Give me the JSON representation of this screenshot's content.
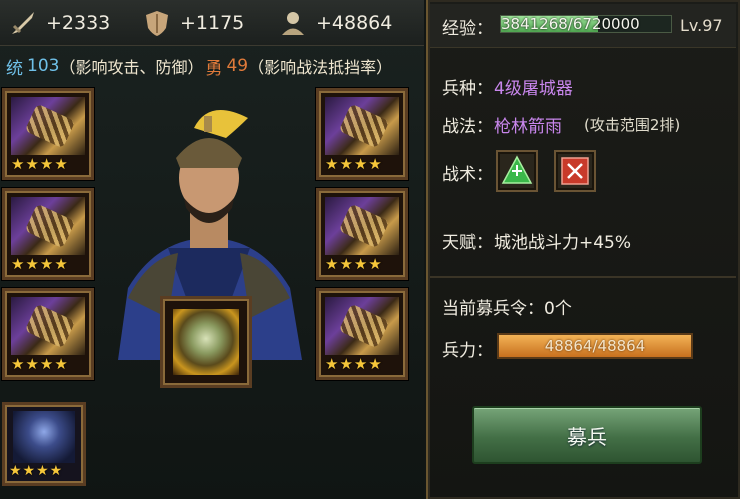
{
  "stats": {
    "attack": "+2333",
    "defense": "+1175",
    "troops": "+48864"
  },
  "attributes": {
    "command_label": "统",
    "command_value": "103",
    "command_note": "（影响攻击、防御）",
    "valor_label": "勇",
    "valor_value": "49",
    "valor_note": "（影响战法抵挡率）"
  },
  "equipment": {
    "slot_stars": "★★★★",
    "hero_stars": "★★★★"
  },
  "info": {
    "exp_label": "经验：",
    "exp_text": "3841268/6720000",
    "exp_current": 3841268,
    "exp_max": 6720000,
    "level": "Lv.97",
    "unit_label": "兵种：",
    "unit_value": "4级屠城器",
    "skill_label": "战法：",
    "skill_value": "枪林箭雨",
    "skill_note": "(攻击范围2排)",
    "tactics_label": "战术：",
    "talent_label": "天赋：",
    "talent_value": "城池战斗力+45%",
    "recruit_token_label": "当前募兵令：0个",
    "troop_label": "兵力：",
    "troop_text": "48864/48864",
    "troop_fraction": 1.0,
    "recruit_button": "募兵"
  },
  "colors": {
    "accent_gold": "#f5c63a",
    "command": "#6fc0e8",
    "valor": "#e07a3a",
    "purple": "#c886ec",
    "button_green": "#436f46"
  },
  "icons": {
    "attack": "sword-icon",
    "defense": "shield-icon",
    "troops": "soldier-icon",
    "tactic1": "green-triangle-tactic-icon",
    "tactic2": "red-x-tactic-icon"
  }
}
